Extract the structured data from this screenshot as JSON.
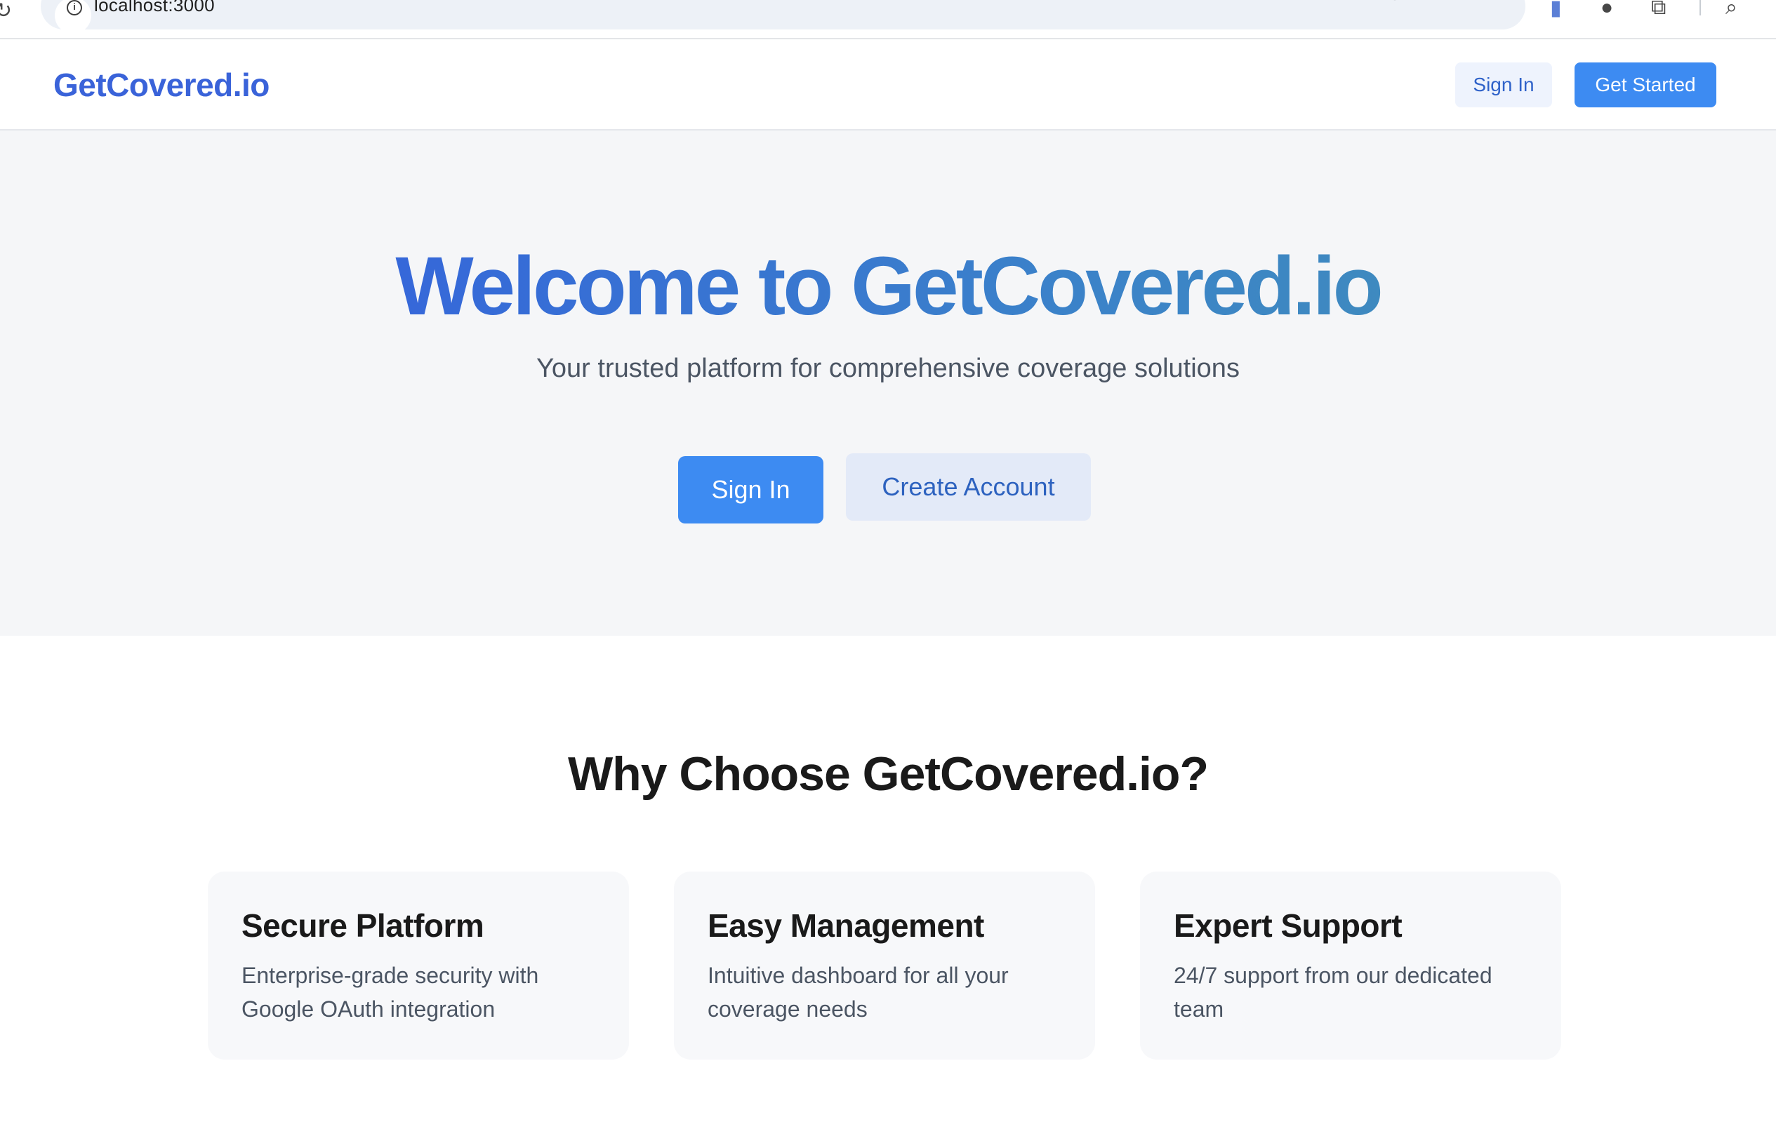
{
  "browser": {
    "url": "localhost:3000"
  },
  "nav": {
    "logo": "GetCovered.io",
    "sign_in": "Sign In",
    "get_started": "Get Started"
  },
  "hero": {
    "title": "Welcome to GetCovered.io",
    "subtitle": "Your trusted platform for comprehensive coverage solutions",
    "sign_in": "Sign In",
    "create_account": "Create Account"
  },
  "features": {
    "title": "Why Choose GetCovered.io?",
    "cards": [
      {
        "title": "Secure Platform",
        "description": "Enterprise-grade security with Google OAuth integration"
      },
      {
        "title": "Easy Management",
        "description": "Intuitive dashboard for all your coverage needs"
      },
      {
        "title": "Expert Support",
        "description": "24/7 support from our dedicated team"
      }
    ]
  },
  "colors": {
    "brand_blue": "#3a63d9",
    "primary_button": "#3d8bf2",
    "secondary_button": "#e3eaf8",
    "hero_background": "#f5f6f8"
  }
}
